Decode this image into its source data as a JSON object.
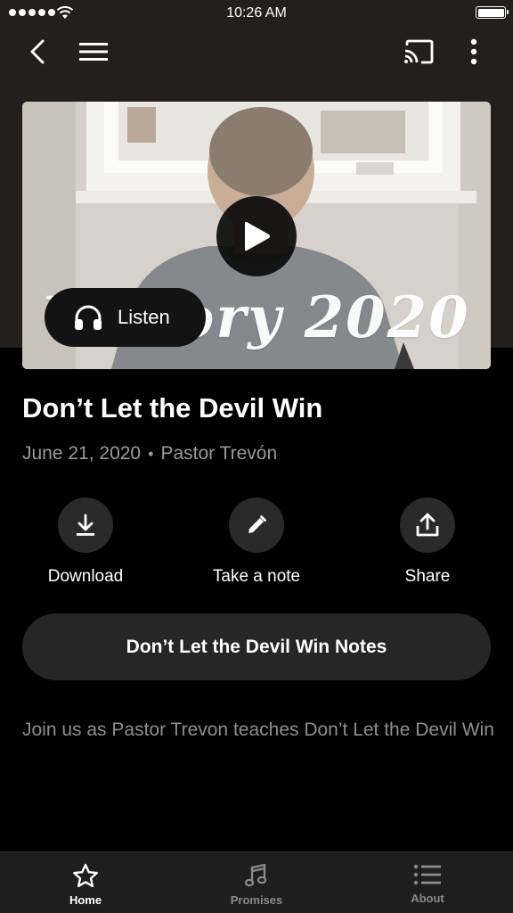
{
  "status_bar": {
    "time": "10:26 AM"
  },
  "hero": {
    "overlay_title": "Victory 2020",
    "listen_label": "Listen"
  },
  "sermon": {
    "title": "Don’t Let the Devil Win",
    "date": "June 21, 2020",
    "separator": "•",
    "speaker": "Pastor Trevón"
  },
  "actions": [
    {
      "label": "Download",
      "icon": "download-icon"
    },
    {
      "label": "Take a note",
      "icon": "pencil-icon"
    },
    {
      "label": "Share",
      "icon": "share-icon"
    }
  ],
  "notes_button": {
    "label": "Don’t Let the Devil Win Notes"
  },
  "description": "Join us as Pastor Trevon teaches Don’t Let the Devil Win",
  "tab_bar": {
    "tabs": [
      {
        "label": "Home",
        "icon": "star-icon",
        "active": true
      },
      {
        "label": "Promises",
        "icon": "music-note-icon",
        "active": false
      },
      {
        "label": "About",
        "icon": "list-icon",
        "active": false
      }
    ]
  },
  "colors": {
    "background": "#000000",
    "top_band": "#221f1c",
    "button_bg": "#262626",
    "muted_text": "#8e8e8e"
  }
}
